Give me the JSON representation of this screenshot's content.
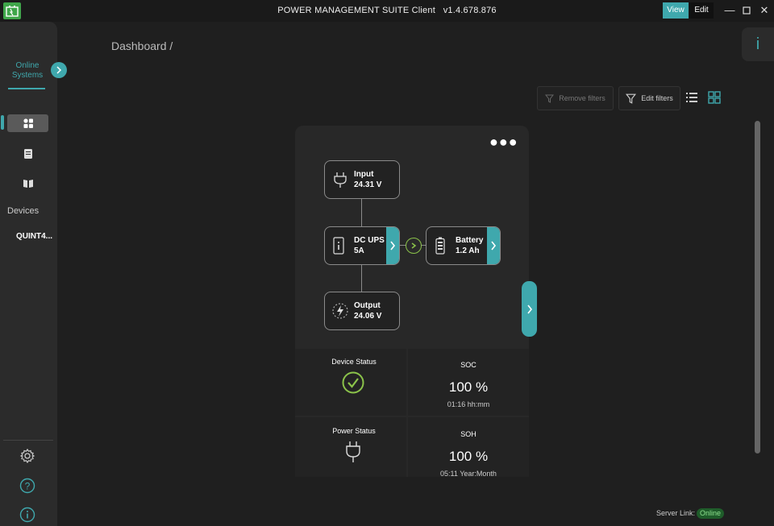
{
  "titlebar": {
    "title": "POWER MANAGEMENT SUITE Client   v1.4.678.876",
    "view_label": "View",
    "edit_label": "Edit",
    "icons": [
      "app-logo-icon",
      "minimize-icon",
      "maximize-icon",
      "close-icon"
    ]
  },
  "sidebar": {
    "online_systems": "Online Systems",
    "devices_label": "Devices",
    "device_item": "QUINT4...",
    "nav_icons": [
      "dashboard-icon",
      "device-icon",
      "book-icon"
    ],
    "bottom_icons": [
      "settings-icon",
      "help-icon",
      "info-icon"
    ]
  },
  "main": {
    "breadcrumb": "Dashboard /",
    "remove_filters": "Remove filters",
    "edit_filters": "Edit filters",
    "server_link_label": "Server Link:",
    "server_status": "Online"
  },
  "card": {
    "nodes": {
      "input": {
        "label": "Input",
        "value": "24.31 V"
      },
      "dcups": {
        "label": "DC UPS",
        "value": "5A"
      },
      "battery": {
        "label": "Battery",
        "value": "1.2 Ah"
      },
      "output": {
        "label": "Output",
        "value": "24.06 V"
      }
    },
    "device_status": "Device Status",
    "power_status": "Power Status",
    "soc": {
      "title": "SOC",
      "value": "100 %",
      "sub": "01:16 hh:mm"
    },
    "soh": {
      "title": "SOH",
      "value": "100 %",
      "sub": "05:11 Year:Month"
    }
  },
  "colors": {
    "accent": "#3fa8ad",
    "ok_green": "#8bc34a",
    "logo_green": "#3fa64a"
  }
}
